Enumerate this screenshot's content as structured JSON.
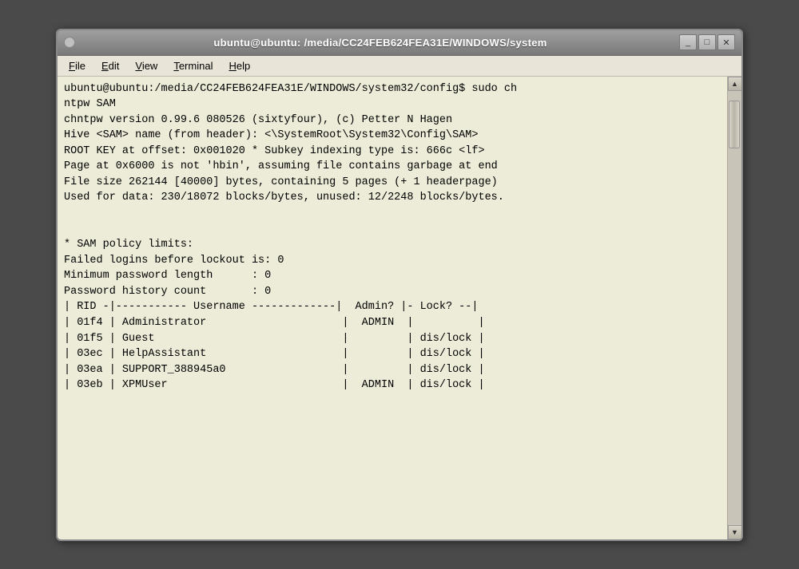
{
  "titleBar": {
    "title": "ubuntu@ubuntu: /media/CC24FEB624FEA31E/WINDOWS/system",
    "minimizeLabel": "_",
    "maximizeLabel": "□",
    "closeLabel": "✕"
  },
  "menuBar": {
    "items": [
      {
        "label": "File",
        "underline": "F"
      },
      {
        "label": "Edit",
        "underline": "E"
      },
      {
        "label": "View",
        "underline": "V"
      },
      {
        "label": "Terminal",
        "underline": "T"
      },
      {
        "label": "Help",
        "underline": "H"
      }
    ]
  },
  "terminal": {
    "lines": [
      "ubuntu@ubuntu:/media/CC24FEB624FEA31E/WINDOWS/system32/config$ sudo ch",
      "ntpw SAM",
      "chntpw version 0.99.6 080526 (sixtyfour), (c) Petter N Hagen",
      "Hive <SAM> name (from header): <\\SystemRoot\\System32\\Config\\SAM>",
      "ROOT KEY at offset: 0x001020 * Subkey indexing type is: 666c <lf>",
      "Page at 0x6000 is not 'hbin', assuming file contains garbage at end",
      "File size 262144 [40000] bytes, containing 5 pages (+ 1 headerpage)",
      "Used for data: 230/18072 blocks/bytes, unused: 12/2248 blocks/bytes.",
      "",
      "",
      "* SAM policy limits:",
      "Failed logins before lockout is: 0",
      "Minimum password length      : 0",
      "Password history count       : 0",
      "| RID -|----------- Username -------------|  Admin? |- Lock? --|",
      "| 01f4 | Administrator                     |  ADMIN  |          |",
      "| 01f5 | Guest                             |         | dis/lock |",
      "| 03ec | HelpAssistant                     |         | dis/lock |",
      "| 03ea | SUPPORT_388945a0                  |         | dis/lock |",
      "| 03eb | XPMUser                           |  ADMIN  | dis/lock |"
    ]
  },
  "scrollbar": {
    "upArrow": "▲",
    "downArrow": "▼"
  }
}
